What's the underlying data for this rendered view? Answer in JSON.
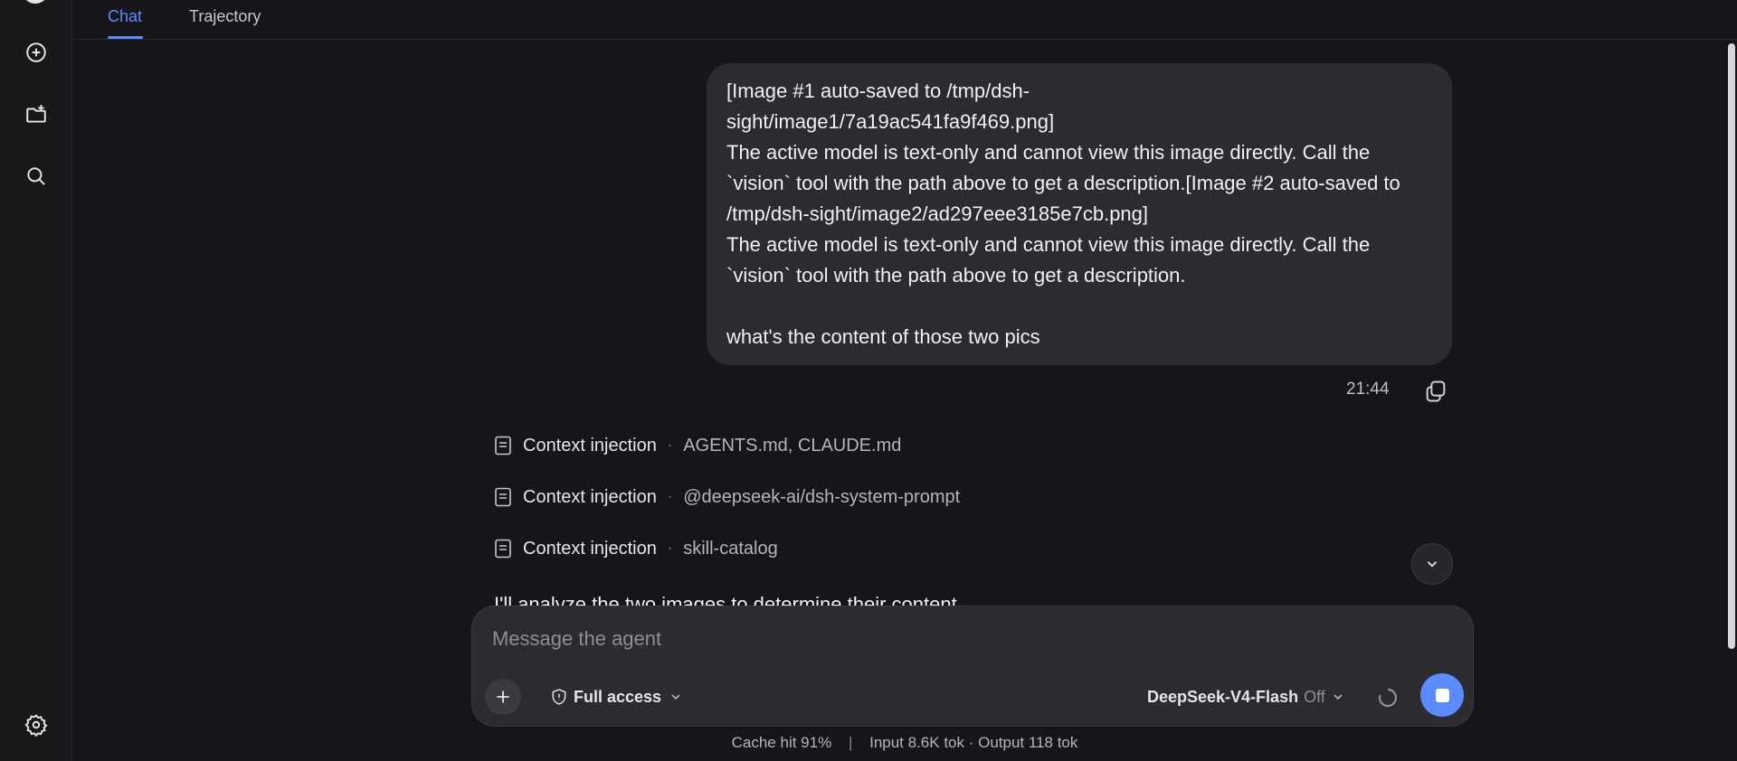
{
  "tabs": {
    "chat": "Chat",
    "trajectory": "Trajectory"
  },
  "user_message": {
    "text": "[Image #1 auto-saved to /tmp/dsh-\nsight/image1/7a19ac541fa9f469.png]\nThe active model is text-only and cannot view this image directly. Call the `vision` tool with the path above to get a description.[Image #2 auto-saved to /tmp/dsh-sight/image2/ad297eee3185e7cb.png]\nThe active model is text-only and cannot view this image directly. Call the `vision` tool with the path above to get a description.\n\nwhat's the content of those two pics",
    "time": "21:44"
  },
  "context_injections": [
    {
      "label": "Context injection",
      "detail": "AGENTS.md, CLAUDE.md"
    },
    {
      "label": "Context injection",
      "detail": "@deepseek-ai/dsh-system-prompt"
    },
    {
      "label": "Context injection",
      "detail": "skill-catalog"
    }
  ],
  "assistant_message": "I'll analyze the two images to determine their content.",
  "composer": {
    "placeholder": "Message the agent",
    "access_label": "Full access",
    "model_name": "DeepSeek-V4-Flash",
    "model_mode": "Off"
  },
  "stats": {
    "cache": "Cache hit 91%",
    "separator": "|",
    "tokens": "Input 8.6K tok · Output 118 tok"
  },
  "icons": {
    "sidebar": [
      "plus-circle-icon",
      "new-folder-icon",
      "search-icon",
      "gear-icon"
    ],
    "composer": [
      "plus-icon",
      "shield-icon",
      "chevron-down-icon",
      "spinner-icon",
      "stop-icon"
    ],
    "message": [
      "copy-icon",
      "document-icon",
      "chevron-down-icon"
    ]
  },
  "colors": {
    "accent": "#5b8cff",
    "background": "#16161a",
    "bubble": "#2b2b30"
  }
}
